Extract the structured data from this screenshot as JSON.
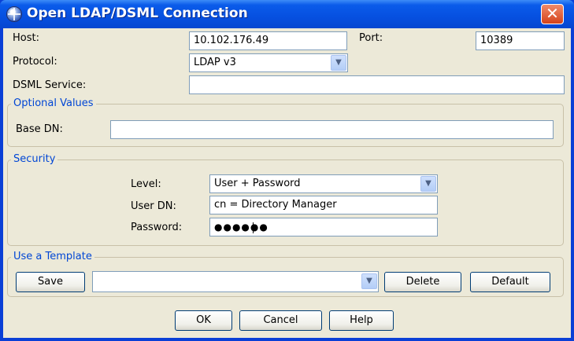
{
  "window": {
    "title": "Open LDAP/DSML Connection",
    "close_label": "✕"
  },
  "connection": {
    "host_label": "Host:",
    "host_value": "10.102.176.49",
    "port_label": "Port:",
    "port_value": "10389",
    "protocol_label": "Protocol:",
    "protocol_value": "LDAP v3",
    "dsml_label": "DSML Service:",
    "dsml_value": ""
  },
  "optional": {
    "title": "Optional Values",
    "base_dn_label": "Base DN:",
    "base_dn_value": ""
  },
  "security": {
    "title": "Security",
    "level_label": "Level:",
    "level_value": "User + Password",
    "user_dn_label": "User DN:",
    "user_dn_value": "cn = Directory Manager",
    "password_label": "Password:",
    "password_value": "●●●●●●"
  },
  "template": {
    "title": "Use a Template",
    "save_label": "Save",
    "template_value": "",
    "delete_label": "Delete",
    "default_label": "Default"
  },
  "footer": {
    "ok_label": "OK",
    "cancel_label": "Cancel",
    "help_label": "Help"
  },
  "icons": {
    "dropdown": "chevron-down-icon",
    "app": "ldap-connection-icon",
    "close": "close-icon"
  }
}
